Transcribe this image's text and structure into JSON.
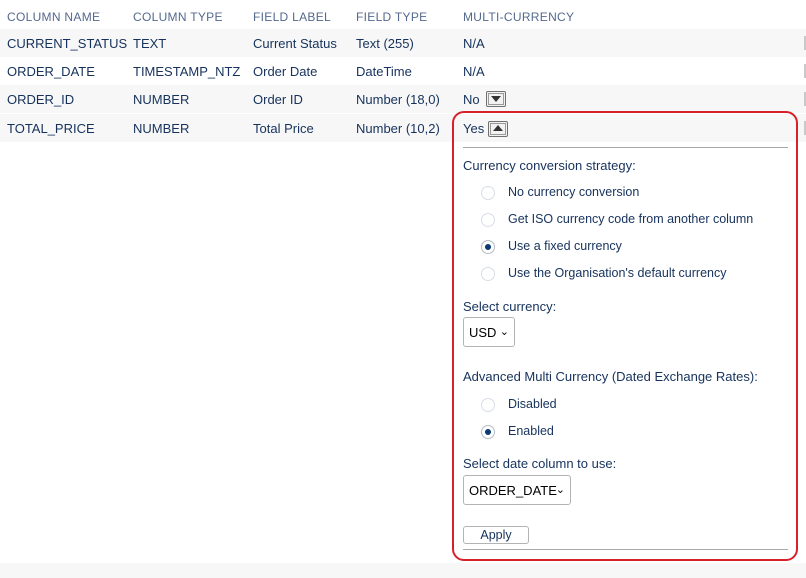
{
  "headers": {
    "column_name": "COLUMN NAME",
    "column_type": "COLUMN TYPE",
    "field_label": "FIELD LABEL",
    "field_type": "FIELD TYPE",
    "multi_currency": "MULTI-CURRENCY"
  },
  "rows": [
    {
      "column_name": "CURRENT_STATUS",
      "column_type": "TEXT",
      "field_label": "Current Status",
      "field_type": "Text (255)",
      "multi_currency": "N/A"
    },
    {
      "column_name": "ORDER_DATE",
      "column_type": "TIMESTAMP_NTZ",
      "field_label": "Order Date",
      "field_type": "DateTime",
      "multi_currency": "N/A"
    },
    {
      "column_name": "ORDER_ID",
      "column_type": "NUMBER",
      "field_label": "Order ID",
      "field_type": "Number (18,0)",
      "multi_currency": "No"
    },
    {
      "column_name": "TOTAL_PRICE",
      "column_type": "NUMBER",
      "field_label": "Total Price",
      "field_type": "Number (10,2)",
      "multi_currency": "Yes"
    }
  ],
  "panel": {
    "strategy_heading": "Currency conversion strategy:",
    "strategy_options": [
      {
        "label": "No currency conversion",
        "selected": false
      },
      {
        "label": "Get ISO currency code from another column",
        "selected": false
      },
      {
        "label": "Use a fixed currency",
        "selected": true
      },
      {
        "label": "Use the Organisation's default currency",
        "selected": false
      }
    ],
    "currency_heading": "Select currency:",
    "currency_value": "USD",
    "advanced_heading": "Advanced Multi Currency (Dated Exchange Rates):",
    "advanced_options": [
      {
        "label": "Disabled",
        "selected": false
      },
      {
        "label": "Enabled",
        "selected": true
      }
    ],
    "date_column_heading": "Select date column to use:",
    "date_column_value": "ORDER_DATE",
    "apply_label": "Apply"
  },
  "colors": {
    "highlight": "#d8202a",
    "text": "#16325c",
    "header_text": "#54698d",
    "radio_selected": "#0b3a75"
  },
  "icons": {
    "dropdown": "chevron-down-icon",
    "expand": "triangle-down-icon",
    "collapse": "triangle-up-icon"
  }
}
